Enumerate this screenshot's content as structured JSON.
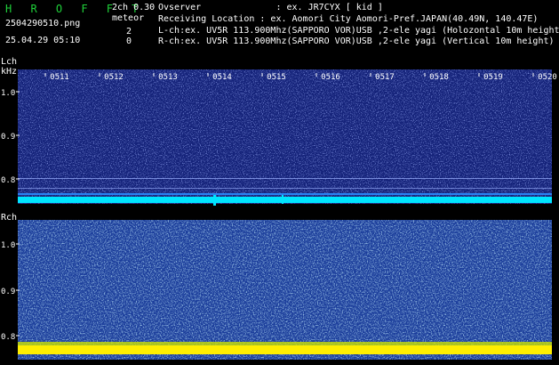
{
  "header": {
    "logo": "H R O F F T",
    "filename": "2504290510.png",
    "datetime": "25.04.29 05:10",
    "version": "2ch 0.30",
    "meteor_label": "meteor",
    "meteor_count_l": "2",
    "meteor_count_r": "0",
    "observer": "Ovserver              : ex. JR7CYX [ kid ]",
    "location": "Receiving Location : ex. Aomori City Aomori-Pref.JAPAN(40.49N, 140.47E)",
    "lch_info": "L-ch:ex. UV5R 113.900Mhz(SAPPORO VOR)USB ,2-ele yagi (Holozontal 10m height)",
    "rch_info": "R-ch:ex. UV5R 113.900Mhz(SAPPORO VOR)USB ,2-ele yagi (Vertical 10m height)"
  },
  "lch": {
    "label": "Lch",
    "unit": "kHz",
    "time_ticks": [
      "0511",
      "0512",
      "0513",
      "0514",
      "0515",
      "0516",
      "0517",
      "0518",
      "0519",
      "0520"
    ],
    "freq_ticks": [
      "1.0",
      "0.9",
      "0.8"
    ]
  },
  "rch": {
    "label": "Rch",
    "freq_ticks": [
      "1.0",
      "0.9",
      "0.8"
    ]
  },
  "colors": {
    "logo": "#1fd23a",
    "background": "#000000",
    "lch_noise": "#1a2a8c",
    "rch_noise": "#2a5ab8",
    "lch_carrier": "#00e5ff",
    "rch_carrier": "#ffee00"
  }
}
